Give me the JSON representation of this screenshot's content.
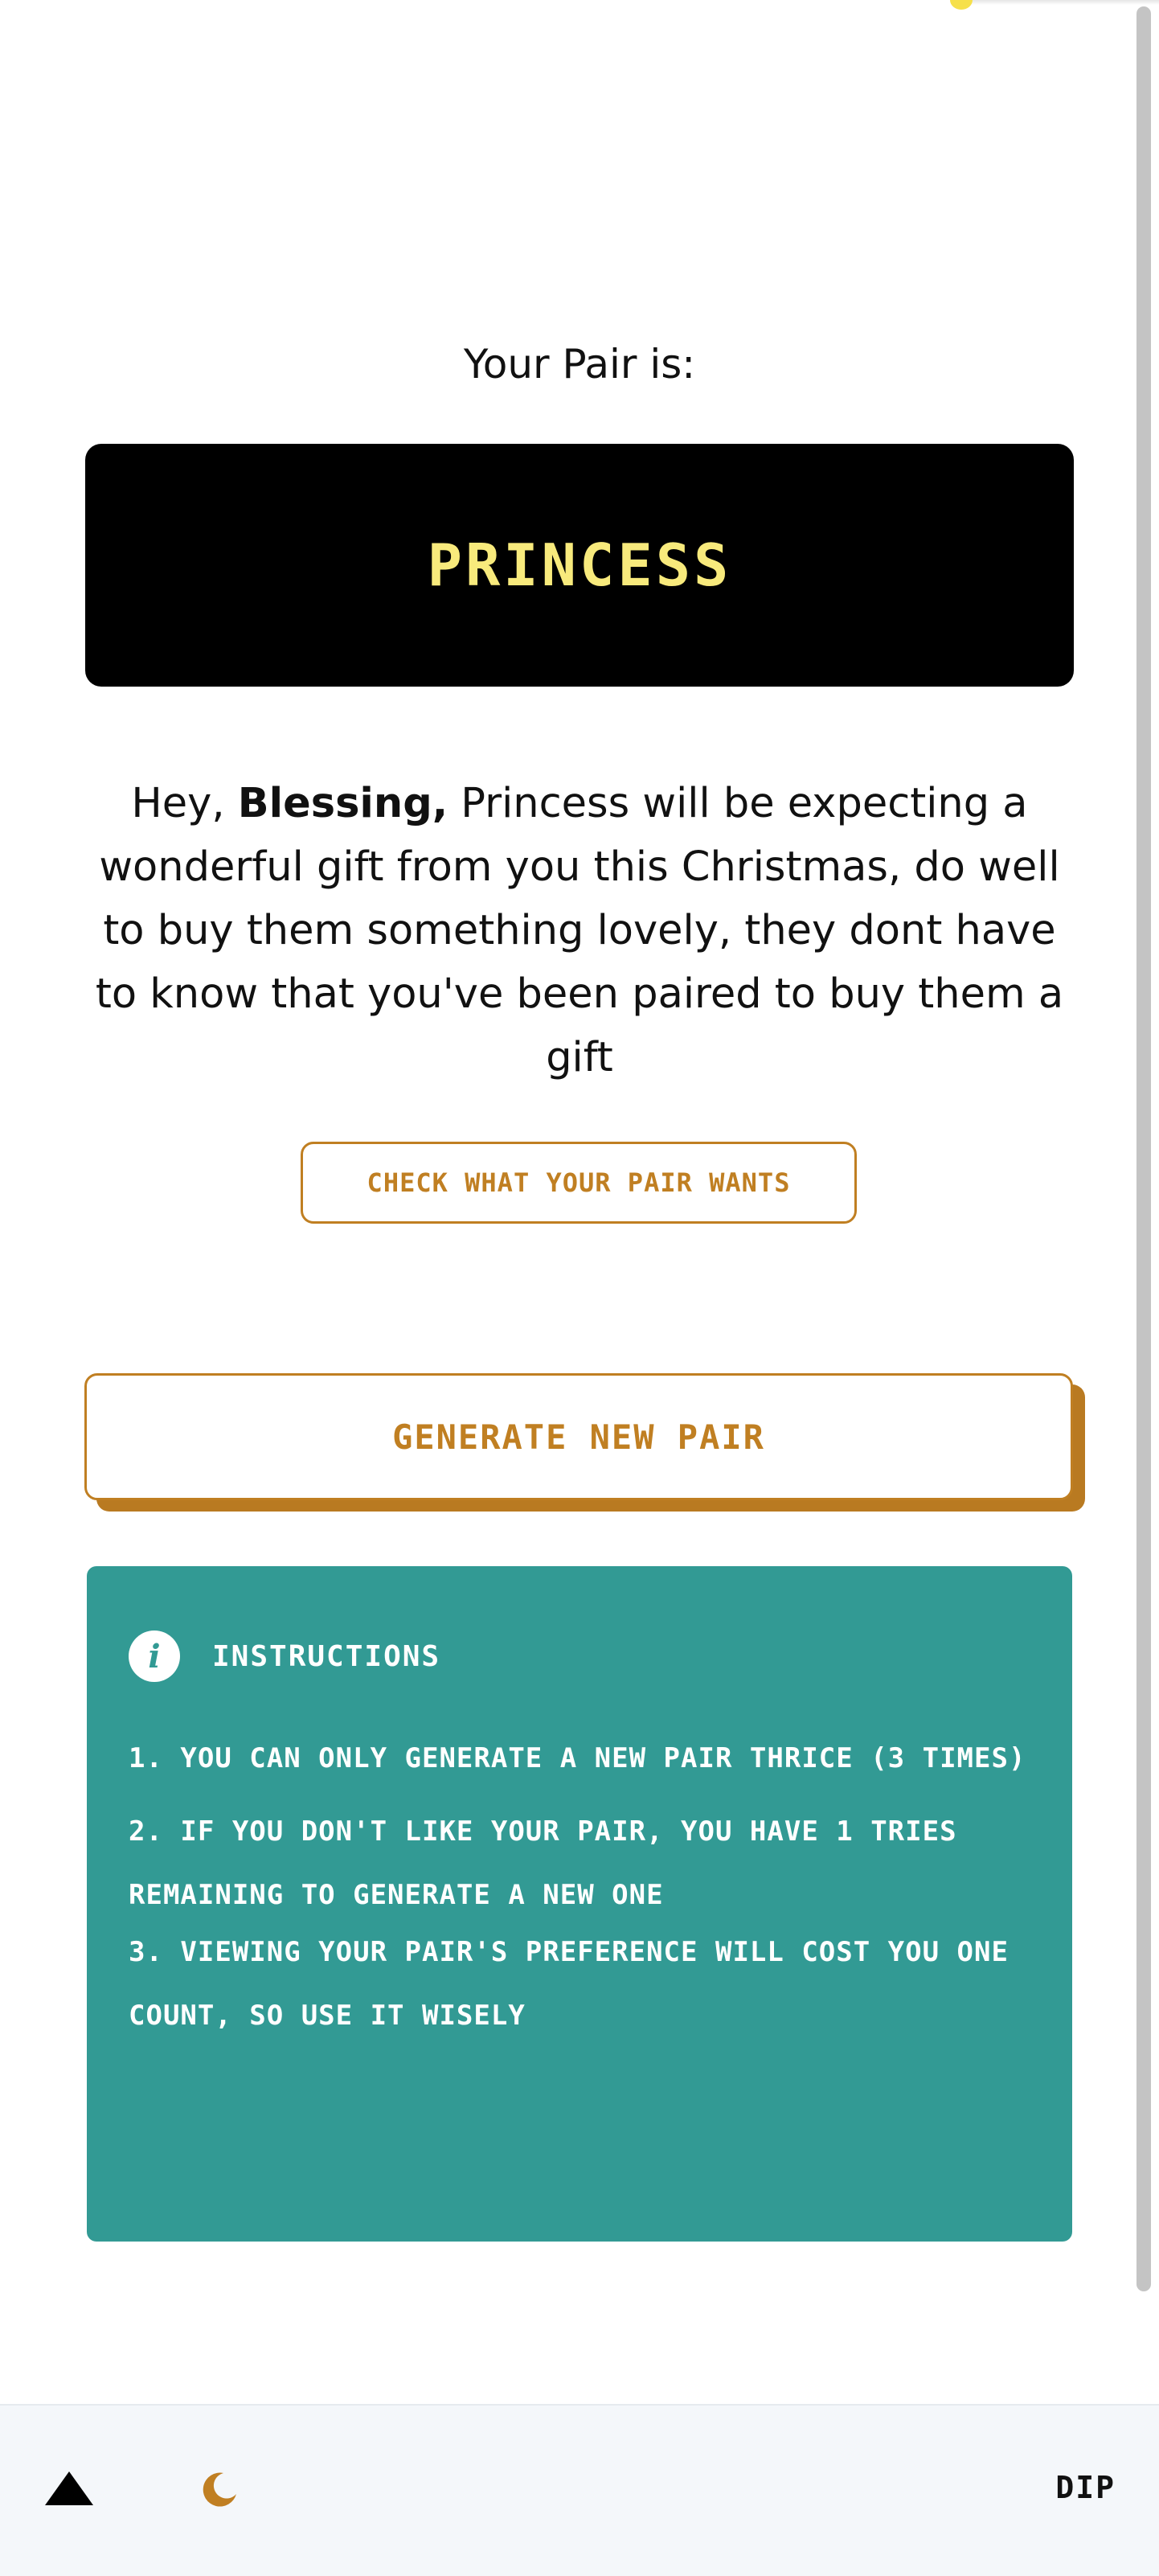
{
  "pair": {
    "heading": "Your Pair is:",
    "name": "PRINCESS"
  },
  "message": {
    "prefix": "Hey, ",
    "user_name": "Blessing,",
    "body": " Princess will be expecting a wonderful gift from you this Christmas, do well to buy them something lovely, they dont have to know that you've been paired to buy them a gift"
  },
  "actions": {
    "check_label": "CHECK WHAT YOUR PAIR WANTS",
    "generate_label": "GENERATE NEW PAIR"
  },
  "instructions": {
    "title": "INSTRUCTIONS",
    "icon": "info-icon",
    "items": [
      "1. YOU CAN ONLY GENERATE A NEW PAIR THRICE (3 TIMES)",
      "2. IF YOU DON'T LIKE YOUR PAIR, YOU HAVE 1 TRIES REMAINING TO GENERATE A NEW ONE",
      "3. VIEWING YOUR PAIR'S PREFERENCE WILL COST YOU ONE COUNT, SO USE IT WISELY"
    ]
  },
  "footer": {
    "logo_icon": "triangle-icon",
    "theme_icon": "moon-icon",
    "label": "DIP"
  },
  "colors": {
    "accent": "#c07f22",
    "pair_text": "#f8ea7c",
    "instructions_bg": "#329a94",
    "footer_bg": "#f4f7fa"
  }
}
